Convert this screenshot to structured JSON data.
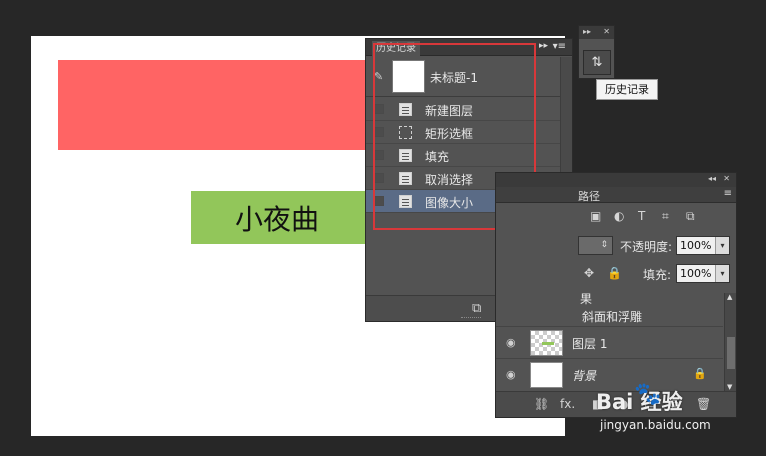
{
  "canvas": {
    "text": "小夜曲"
  },
  "history_panel": {
    "tab": "历史记录",
    "collapse_glyph": "▸▸",
    "menu_glyph": "▾≡",
    "snapshot": {
      "label": "未标题-1",
      "brush_icon": "history-brush-icon"
    },
    "items": [
      {
        "label": "新建图层",
        "icon": "new-layer-icon",
        "selected": false
      },
      {
        "label": "矩形选框",
        "icon": "marquee-icon",
        "selected": false
      },
      {
        "label": "填充",
        "icon": "fill-icon",
        "selected": false
      },
      {
        "label": "取消选择",
        "icon": "deselect-icon",
        "selected": false
      },
      {
        "label": "图像大小",
        "icon": "image-size-icon",
        "selected": true
      }
    ],
    "bottom_buttons": {
      "new_document_glyph": "⧉",
      "snapshot_glyph": "◙",
      "delete_glyph": "🗑"
    }
  },
  "mini_dock": {
    "header_left": "▸▸",
    "header_right": "✕",
    "button_glyph": "⇅",
    "tooltip": "历史记录"
  },
  "layers_panel": {
    "header_collapse": "◂◂",
    "header_close": "✕",
    "tab": "路径",
    "menu_glyph": "≡",
    "filter_icons": [
      "▣",
      "◐",
      "T",
      "⌗",
      "⧉"
    ],
    "opacity_label": "不透明度:",
    "opacity_value": "100%",
    "fill_label": "填充:",
    "fill_value": "100%",
    "move_glyph": "✥",
    "lock_glyph": "🔒",
    "effects_label": "果",
    "bevel_label": "斜面和浮雕",
    "layers": [
      {
        "name": "图层 1",
        "thumb": "checker",
        "italic": false,
        "locked": false
      },
      {
        "name": "背景",
        "thumb": "white",
        "italic": true,
        "locked": true
      }
    ],
    "bottom_icons": [
      "⛓",
      "fx.",
      "◧",
      "◑",
      "▭",
      "⧉",
      "🗑"
    ]
  },
  "watermark": {
    "logo": "Bai  经验",
    "paw": "🐾",
    "url": "jingyan.baidu.com"
  }
}
